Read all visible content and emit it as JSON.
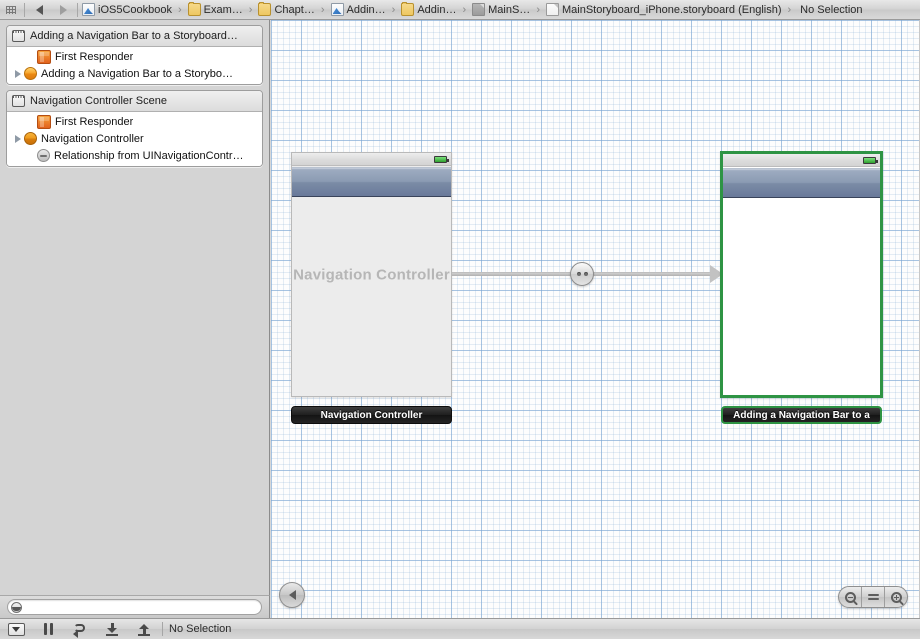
{
  "jumpbar": {
    "grip": "grip-icon",
    "back_arrow": "back-arrow-icon",
    "forward_arrow": "forward-arrow-icon",
    "crumbs": [
      {
        "label": "iOS5Cookbook",
        "icon": "xcodeproj-icon"
      },
      {
        "label": "Exam…",
        "icon": "folder-icon"
      },
      {
        "label": "Chapt…",
        "icon": "folder-icon"
      },
      {
        "label": "Addin…",
        "icon": "xcodeproj-icon"
      },
      {
        "label": "Addin…",
        "icon": "folder-icon"
      },
      {
        "label": "MainS…",
        "icon": "graydoc-icon"
      },
      {
        "label": "MainStoryboard_iPhone.storyboard (English)",
        "icon": "storyboard-doc-icon"
      },
      {
        "label": "No Selection",
        "icon": "none"
      }
    ],
    "separator": "›"
  },
  "sidebar": {
    "scenes": [
      {
        "title": "Adding a Navigation Bar to a Storyboard…",
        "icon": "scene-icon",
        "rows": [
          {
            "label": "First Responder",
            "icon": "first-responder-icon",
            "disclosure": false,
            "indent": 1
          },
          {
            "label": "Adding a Navigation Bar to a Storybo…",
            "icon": "view-controller-icon",
            "disclosure": true,
            "indent": 0
          }
        ]
      },
      {
        "title": "Navigation Controller Scene",
        "icon": "scene-icon",
        "rows": [
          {
            "label": "First Responder",
            "icon": "first-responder-icon",
            "disclosure": false,
            "indent": 1
          },
          {
            "label": "Navigation Controller",
            "icon": "navigation-controller-icon",
            "disclosure": true,
            "indent": 0
          },
          {
            "label": "Relationship from UINavigationContr…",
            "icon": "relationship-icon",
            "disclosure": false,
            "indent": 1
          }
        ]
      }
    ],
    "filter": {
      "placeholder": "",
      "value": "",
      "icon": "filter-lens-icon"
    }
  },
  "canvas": {
    "scenes": [
      {
        "id": "navigation-controller-scene",
        "selected": false,
        "body_label": "Navigation Controller",
        "plaque_label": "Navigation Controller",
        "status_bar": {
          "battery": "battery-icon"
        }
      },
      {
        "id": "adding-navigation-bar-scene",
        "selected": true,
        "body_label": "",
        "plaque_label": "Adding a Navigation Bar to a",
        "status_bar": {
          "battery": "battery-icon"
        }
      }
    ],
    "segue": {
      "type": "relationship",
      "badge_icon": "relationship-segue-icon",
      "arrow_icon": "segue-arrow-icon"
    },
    "back_button": {
      "icon": "canvas-back-icon"
    },
    "zoom_controls": [
      {
        "name": "zoom-out",
        "icon": "zoom-out-icon"
      },
      {
        "name": "zoom-actual-size",
        "icon": "equals-icon"
      },
      {
        "name": "zoom-in",
        "icon": "zoom-in-icon"
      }
    ],
    "colors": {
      "selection_green": "#2e9444",
      "grid_minor": "#dbe7f4",
      "grid_major": "#a9c5e2",
      "navbar_blue": "#8b9bb3"
    }
  },
  "bottombar": {
    "buttons": [
      {
        "name": "scheme-popup",
        "icon": "popup-menu-icon"
      },
      {
        "name": "pause",
        "icon": "pause-icon"
      },
      {
        "name": "continue-loop",
        "icon": "loop-icon"
      },
      {
        "name": "step-into",
        "icon": "step-into-icon"
      },
      {
        "name": "step-out",
        "icon": "step-out-icon"
      }
    ],
    "status": "No Selection"
  }
}
